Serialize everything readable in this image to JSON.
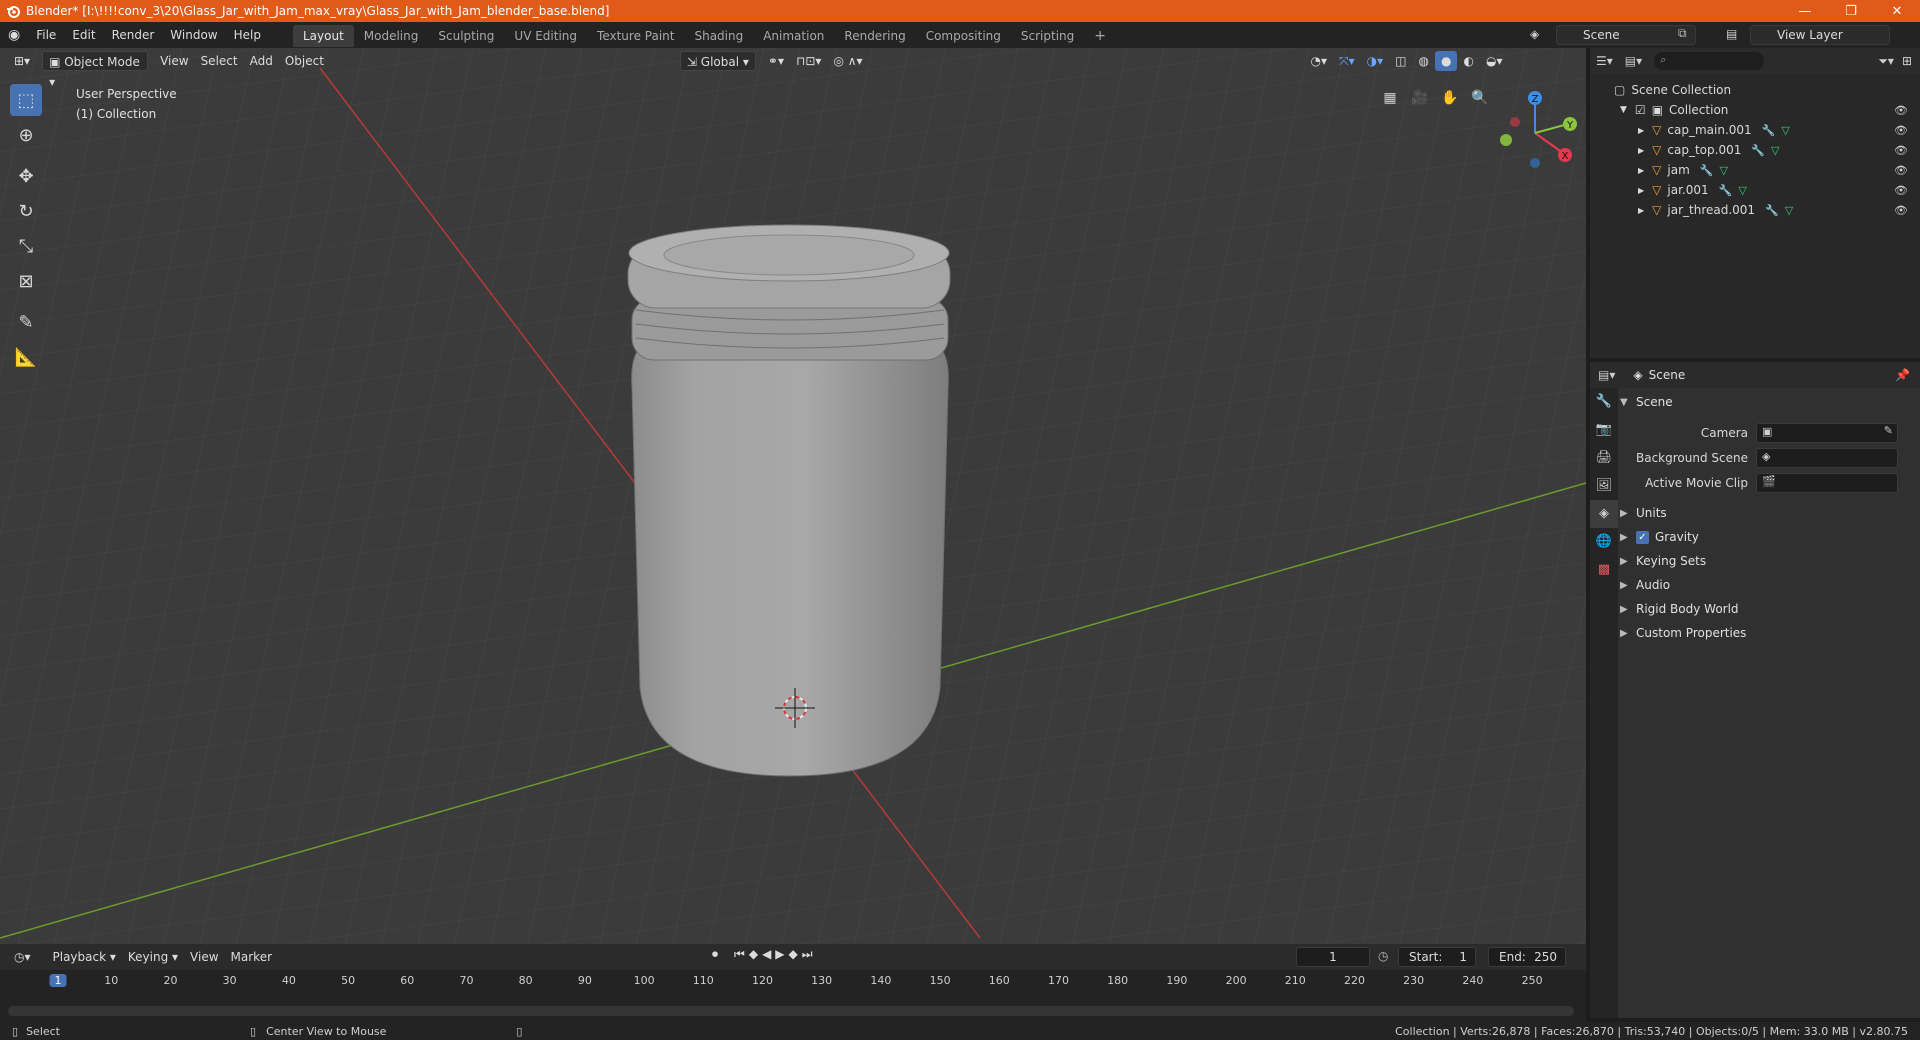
{
  "window": {
    "title": "Blender* [I:\\!!!!conv_3\\20\\Glass_Jar_with_Jam_max_vray\\Glass_Jar_with_Jam_blender_base.blend]",
    "buttons": [
      "—",
      "❐",
      "✕"
    ]
  },
  "menu": [
    "File",
    "Edit",
    "Render",
    "Window",
    "Help"
  ],
  "workspaces": [
    {
      "label": "Layout",
      "active": true
    },
    {
      "label": "Modeling"
    },
    {
      "label": "Sculpting"
    },
    {
      "label": "UV Editing"
    },
    {
      "label": "Texture Paint"
    },
    {
      "label": "Shading"
    },
    {
      "label": "Animation"
    },
    {
      "label": "Rendering"
    },
    {
      "label": "Compositing"
    },
    {
      "label": "Scripting"
    }
  ],
  "scene_selector": {
    "value": "Scene"
  },
  "view_layer_selector": {
    "value": "View Layer"
  },
  "viewport": {
    "mode": "Object Mode",
    "menus": [
      "View",
      "Select",
      "Add",
      "Object"
    ],
    "orientation": "Global",
    "perspective_label": "User Perspective",
    "collection_label": "(1) Collection",
    "gizmo_axes": [
      "X",
      "Y",
      "Z"
    ]
  },
  "outliner": {
    "root": "Scene Collection",
    "collection": "Collection",
    "objects": [
      "cap_main.001",
      "cap_top.001",
      "jam",
      "jar.001",
      "jar_thread.001"
    ]
  },
  "properties": {
    "header": "Scene",
    "panel": "Scene",
    "fields": [
      {
        "label": "Camera"
      },
      {
        "label": "Background Scene"
      },
      {
        "label": "Active Movie Clip"
      }
    ],
    "sections": [
      "Units",
      "Gravity",
      "Keying Sets",
      "Audio",
      "Rigid Body World",
      "Custom Properties"
    ],
    "gravity_checked": true
  },
  "timeline": {
    "menus": [
      "Playback",
      "Keying",
      "View",
      "Marker"
    ],
    "current_frame": "1",
    "start_label": "Start:",
    "start": "1",
    "end_label": "End:",
    "end": "250",
    "ticks": [
      "1",
      "10",
      "20",
      "30",
      "40",
      "50",
      "60",
      "70",
      "80",
      "90",
      "100",
      "110",
      "120",
      "130",
      "140",
      "150",
      "160",
      "170",
      "180",
      "190",
      "200",
      "210",
      "220",
      "230",
      "240",
      "250"
    ]
  },
  "status": {
    "left_action": "Select",
    "middle_action": "Center View to Mouse",
    "stats": "Collection | Verts:26,878 | Faces:26,870 | Tris:53,740 | Objects:0/5 | Mem: 33.0 MB | v2.80.75"
  },
  "colors": {
    "title_bar": "#e05a1a",
    "accent_blue": "#4772b3",
    "x_axis": "#e8384f",
    "y_axis": "#8bc43f",
    "z_axis": "#3d8ee8"
  }
}
